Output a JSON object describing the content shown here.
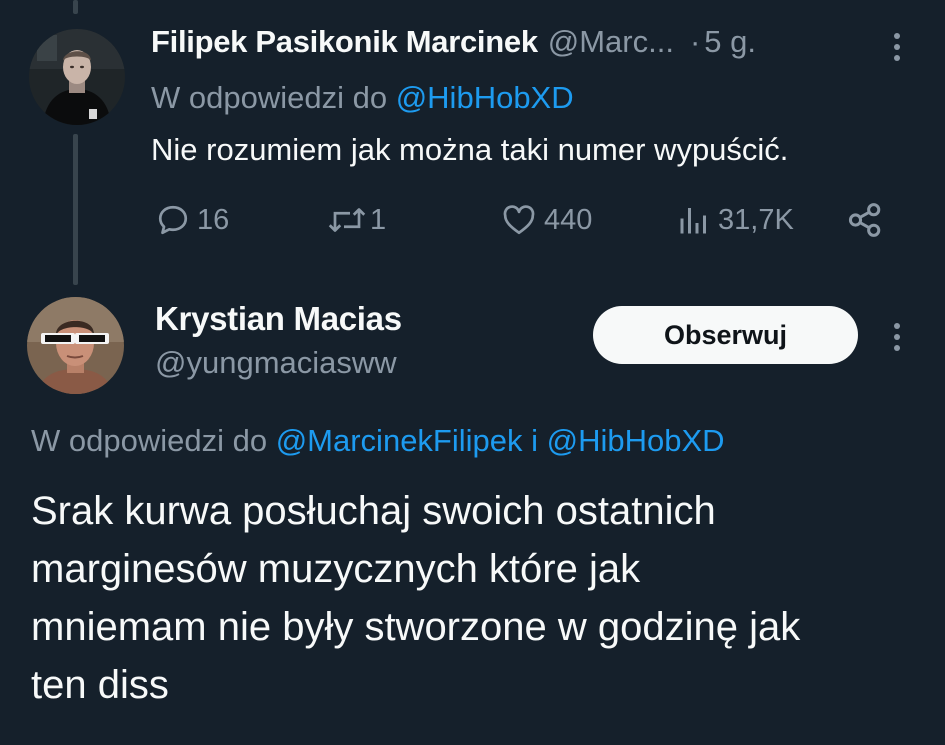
{
  "tweet1": {
    "author_name": "Filipek Pasikonik Marcinek",
    "author_handle": "@Marc...",
    "separator": "·",
    "time": "5 g.",
    "reply_prefix": "W odpowiedzi do",
    "reply_to": "@HibHobXD",
    "text": "Nie rozumiem jak można taki numer wypuścić.",
    "actions": {
      "replies": "16",
      "retweets": "1",
      "likes": "440",
      "views": "31,7K"
    }
  },
  "tweet2": {
    "author_name": "Krystian Macias",
    "author_handle": "@yungmaciasww",
    "follow_label": "Obserwuj",
    "reply_prefix": "W odpowiedzi do",
    "reply_to_1": "@MarcinekFilipek",
    "reply_joiner": "i",
    "reply_to_2": "@HibHobXD",
    "text": "Srak kurwa posłuchaj swoich ostatnich\nmarginesów muzycznych które jak\nmniemam nie były stworzone w godzinę jak\nten diss"
  },
  "icons": {
    "reply": "speech-bubble-icon",
    "retweet": "retweet-arrows-icon",
    "like": "heart-icon",
    "views": "bar-chart-icon",
    "share": "share-nodes-icon",
    "more": "vertical-ellipsis-icon"
  },
  "colors": {
    "background": "#15202b",
    "text": "#f7f9f9",
    "secondary_text": "#8b98a5",
    "link": "#1d9bf0",
    "thread_line": "#38444d",
    "button_bg": "#f7f9f9",
    "button_text": "#0f1419"
  }
}
